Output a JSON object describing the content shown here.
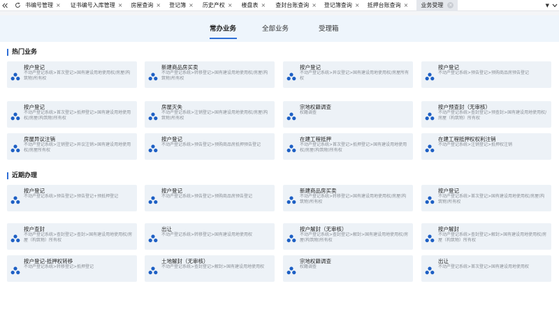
{
  "tabbar": {
    "tabs": [
      {
        "label": "书编号管理",
        "active": false
      },
      {
        "label": "证书编号入库管理",
        "active": false
      },
      {
        "label": "房屋查询",
        "active": false
      },
      {
        "label": "登记簿",
        "active": false
      },
      {
        "label": "历史产权",
        "active": false
      },
      {
        "label": "楼盘表",
        "active": false
      },
      {
        "label": "查封台账查询",
        "active": false
      },
      {
        "label": "登记簿查询",
        "active": false
      },
      {
        "label": "抵押台账查询",
        "active": false
      },
      {
        "label": "业务受理",
        "active": true
      }
    ]
  },
  "subtabs": [
    {
      "label": "常办业务",
      "active": true
    },
    {
      "label": "全部业务",
      "active": false
    },
    {
      "label": "受理箱",
      "active": false
    }
  ],
  "sections": [
    {
      "title": "热门业务",
      "cards": [
        {
          "title": "按户登记",
          "desc": "不动产登记系统>首次登记>国有建设用地使用权/房屋(构筑物)所有权"
        },
        {
          "title": "新建商品房买卖",
          "desc": "不动产登记系统>转移登记>国有建设用地使用权/房屋(构筑物)所有权"
        },
        {
          "title": "按户登记",
          "desc": "不动产登记系统>异议登记>国有建设用地使用权/房屋所有权"
        },
        {
          "title": "按户登记",
          "desc": "不动产登记系统>预告登记>预购商品房预告登记"
        },
        {
          "title": "按户登记",
          "desc": "不动产登记系统>首次登记>抵押登记>国有建设用地使用权/房屋(构筑物)所有权"
        },
        {
          "title": "房屋灭失",
          "desc": "不动产登记系统>注销登记>国有建设用地使用权/房屋(构筑物)所有权"
        },
        {
          "title": "宗地权籍调查",
          "desc": "权籍调查"
        },
        {
          "title": "按户预查封（无审核）",
          "desc": "不动产登记系统>查封登记>预查封>国有建设用地使用权/房屋（构筑物）所有权"
        },
        {
          "title": "房屋异议注销",
          "desc": "不动产登记系统>注销登记>异议注销>国有建设用地使用权/房屋所有权"
        },
        {
          "title": "按户登记",
          "desc": "不动产登记系统>预告登记>预购商品房抵押预告登记"
        },
        {
          "title": "在建工程抵押",
          "desc": "不动产登记系统>首次登记>抵押登记>国有建设用地使用权/房屋(构筑物)所有权"
        },
        {
          "title": "在建工程抵押权权利注销",
          "desc": "不动产登记系统>注销登记>抵押权注销"
        }
      ]
    },
    {
      "title": "近期办理",
      "cards": [
        {
          "title": "按户登记",
          "desc": "不动产登记系统>预告登记>预告登记+预抵押登记"
        },
        {
          "title": "按户登记",
          "desc": "不动产登记系统>预告登记>预购商品房预告登记"
        },
        {
          "title": "新建商品房买卖",
          "desc": "不动产登记系统>转移登记>国有建设用地使用权/房屋(构筑物)所有权"
        },
        {
          "title": "按户登记",
          "desc": "不动产登记系统>首次登记>国有建设用地使用权/房屋(构筑物)所有权"
        },
        {
          "title": "按户查封",
          "desc": "不动产登记系统>查封登记>查封>国有建设用地使用权/房屋（构筑物）所有权"
        },
        {
          "title": "出让",
          "desc": "不动产登记系统>转移登记>国有建设用地使用权"
        },
        {
          "title": "按户解封（无审核）",
          "desc": "不动产登记系统>查封登记>解封>国有建设用地使用权/房屋(构筑物)所有权"
        },
        {
          "title": "按户解封",
          "desc": "不动产登记系统>查封登记>解封>国有建设用地使用权/房屋（构筑物）所有权"
        },
        {
          "title": "按户登记-抵押权转移",
          "desc": "不动产登记系统>转移登记>抵押登记"
        },
        {
          "title": "土地解封（无审核）",
          "desc": "不动产登记系统>查封登记>解封>国有建设用地使用权"
        },
        {
          "title": "宗地权籍调查",
          "desc": "权籍调查"
        },
        {
          "title": "出让",
          "desc": "不动产登记系统>首次登记>国有建设用地使用权"
        }
      ]
    }
  ],
  "colors": {
    "accent": "#2f6fd6",
    "card_bg": "#edf2f7",
    "subtab_bg": "#eef5fc",
    "icon": "#1d5fc4"
  },
  "icons": {
    "back": "double-chevron-left-icon",
    "refresh": "refresh-icon",
    "close": "close-icon",
    "more": "triangle-down-icon",
    "menu": "chevron-down-icon",
    "card": "cubes-icon"
  }
}
